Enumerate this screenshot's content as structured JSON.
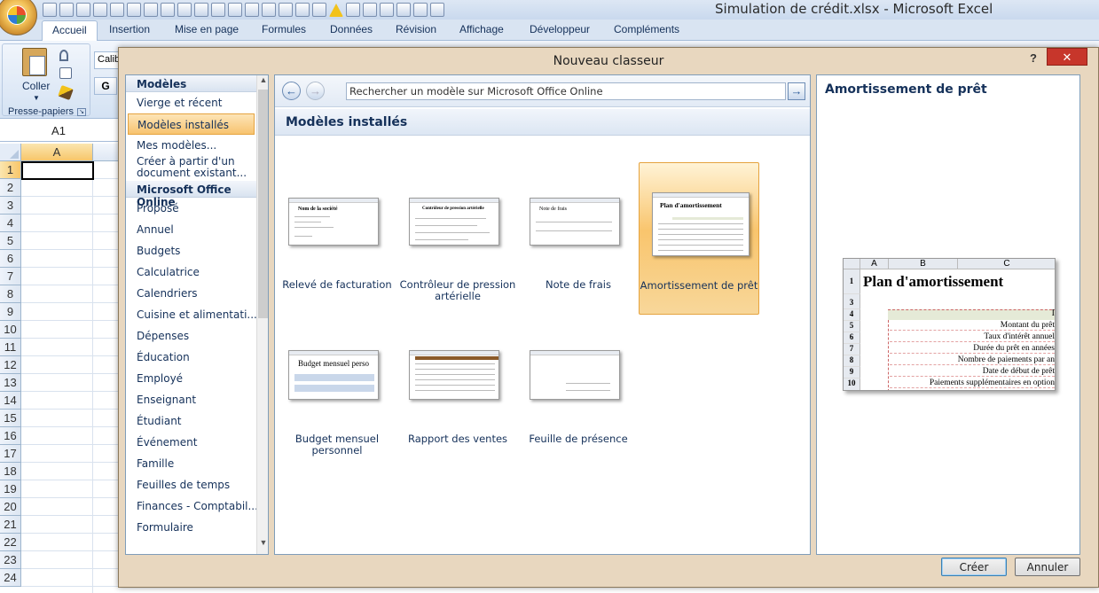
{
  "app": {
    "title": "Simulation de crédit.xlsx - Microsoft Excel",
    "tabs": [
      "Accueil",
      "Insertion",
      "Mise en page",
      "Formules",
      "Données",
      "Révision",
      "Affichage",
      "Développeur",
      "Compléments"
    ],
    "active_tab": "Accueil"
  },
  "ribbon": {
    "coller_label": "Coller",
    "clipboard_group": "Presse-papiers",
    "font_partial": "Calib",
    "bold": "G"
  },
  "formula_bar": {
    "name_box": "A1"
  },
  "sheet": {
    "column_a": "A",
    "rows": [
      "1",
      "2",
      "3",
      "4",
      "5",
      "6",
      "7",
      "8",
      "9",
      "10",
      "11",
      "12",
      "13",
      "14",
      "15",
      "16",
      "17",
      "18",
      "19",
      "20",
      "21",
      "22",
      "23",
      "24"
    ]
  },
  "dialog": {
    "title": "Nouveau classeur",
    "help": "?",
    "close": "✕",
    "nav": [
      {
        "type": "head",
        "label": "Modèles"
      },
      {
        "type": "item",
        "label": "Vierge et récent"
      },
      {
        "type": "item",
        "label": "Modèles installés",
        "selected": true
      },
      {
        "type": "item",
        "label": "Mes modèles..."
      },
      {
        "type": "item",
        "label": "Créer à partir d'un document existant...",
        "multi": true
      },
      {
        "type": "head",
        "label": "Microsoft Office Online"
      },
      {
        "type": "item",
        "label": "Proposé"
      },
      {
        "type": "item",
        "label": "Annuel"
      },
      {
        "type": "item",
        "label": "Budgets"
      },
      {
        "type": "item",
        "label": "Calculatrice"
      },
      {
        "type": "item",
        "label": "Calendriers"
      },
      {
        "type": "item",
        "label": "Cuisine et alimentati..."
      },
      {
        "type": "item",
        "label": "Dépenses"
      },
      {
        "type": "item",
        "label": "Éducation"
      },
      {
        "type": "item",
        "label": "Employé"
      },
      {
        "type": "item",
        "label": "Enseignant"
      },
      {
        "type": "item",
        "label": "Étudiant"
      },
      {
        "type": "item",
        "label": "Événement"
      },
      {
        "type": "item",
        "label": "Famille"
      },
      {
        "type": "item",
        "label": "Feuilles de temps"
      },
      {
        "type": "item",
        "label": "Finances - Comptabil..."
      },
      {
        "type": "item",
        "label": "Formulaire"
      }
    ],
    "search_placeholder": "Rechercher un modèle sur Microsoft Office Online",
    "section_title": "Modèles installés",
    "templates": [
      {
        "label": "Relevé de facturation",
        "thumb_title": "Nom de la société"
      },
      {
        "label": "Contrôleur de pression artérielle",
        "thumb_title": "Contrôleur de pression artérielle"
      },
      {
        "label": "Note de frais",
        "thumb_title": "Note de frais"
      },
      {
        "label": "Amortissement de prêt",
        "thumb_title": "Plan d'amortissement",
        "selected": true
      },
      {
        "label": "Budget mensuel personnel",
        "thumb_title": "Budget mensuel perso"
      },
      {
        "label": "Rapport des ventes",
        "thumb_title": ""
      },
      {
        "label": "Feuille de présence",
        "thumb_title": ""
      }
    ],
    "preview": {
      "title": "Amortissement de prêt",
      "sheet_title": "Plan d'amortissement",
      "columns": [
        "A",
        "B",
        "C"
      ],
      "rows": [
        "1",
        "3",
        "4",
        "5",
        "6",
        "7",
        "8",
        "9",
        "10"
      ],
      "band_text": "I",
      "lines": [
        "Montant du prêt",
        "Taux d'intérêt annuel",
        "Durée du prêt en années",
        "Nombre de paiements par an",
        "Date de début de prêt",
        "Paiements supplémentaires en option"
      ]
    },
    "buttons": {
      "create": "Créer",
      "cancel": "Annuler"
    }
  }
}
